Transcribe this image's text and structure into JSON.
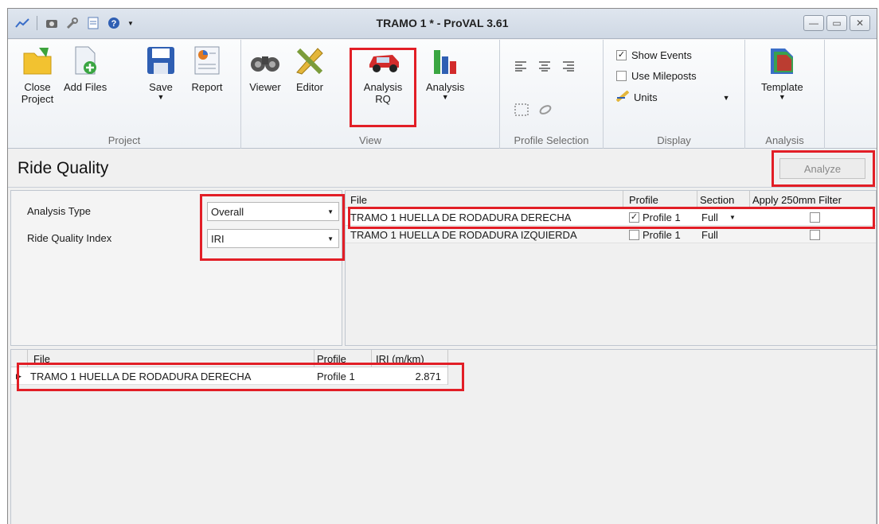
{
  "window": {
    "title": "TRAMO 1 * - ProVAL 3.61"
  },
  "ribbon": {
    "project_group": {
      "label": "Project",
      "close_project": "Close Project",
      "add_files": "Add Files",
      "save": "Save",
      "report": "Report"
    },
    "view_group": {
      "label": "View",
      "viewer": "Viewer",
      "editor": "Editor",
      "analysis_rq": "Analysis RQ",
      "analysis": "Analysis"
    },
    "profile_selection_group": {
      "label": "Profile Selection"
    },
    "display_group": {
      "label": "Display",
      "show_events": "Show Events",
      "show_events_checked": true,
      "use_mileposts": "Use Mileposts",
      "use_mileposts_checked": false,
      "units": "Units"
    },
    "analysis_group": {
      "label": "Analysis",
      "template": "Template"
    }
  },
  "ride_quality": {
    "title": "Ride Quality",
    "analyze_button": "Analyze"
  },
  "settings": {
    "analysis_type_label": "Analysis Type",
    "analysis_type_value": "Overall",
    "ride_quality_index_label": "Ride Quality Index",
    "ride_quality_index_value": "IRI"
  },
  "file_grid": {
    "headers": {
      "file": "File",
      "profile": "Profile",
      "section": "Section",
      "filter": "Apply 250mm Filter"
    },
    "rows": [
      {
        "file": "TRAMO 1 HUELLA DE RODADURA DERECHA",
        "profile": "Profile 1",
        "profile_checked": true,
        "section": "Full",
        "filter_checked": false
      },
      {
        "file": "TRAMO 1 HUELLA DE RODADURA IZQUIERDA",
        "profile": "Profile 1",
        "profile_checked": false,
        "section": "Full",
        "filter_checked": false
      }
    ]
  },
  "results": {
    "headers": {
      "file": "File",
      "profile": "Profile",
      "iri": "IRI (m/km)"
    },
    "rows": [
      {
        "file": "TRAMO 1 HUELLA DE RODADURA DERECHA",
        "profile": "Profile 1",
        "iri": "2.871"
      }
    ]
  },
  "colors": {
    "highlight": "#e21e26",
    "ribbon_bg": "#f4f6f9",
    "title_bg": "#d8e0ea"
  }
}
